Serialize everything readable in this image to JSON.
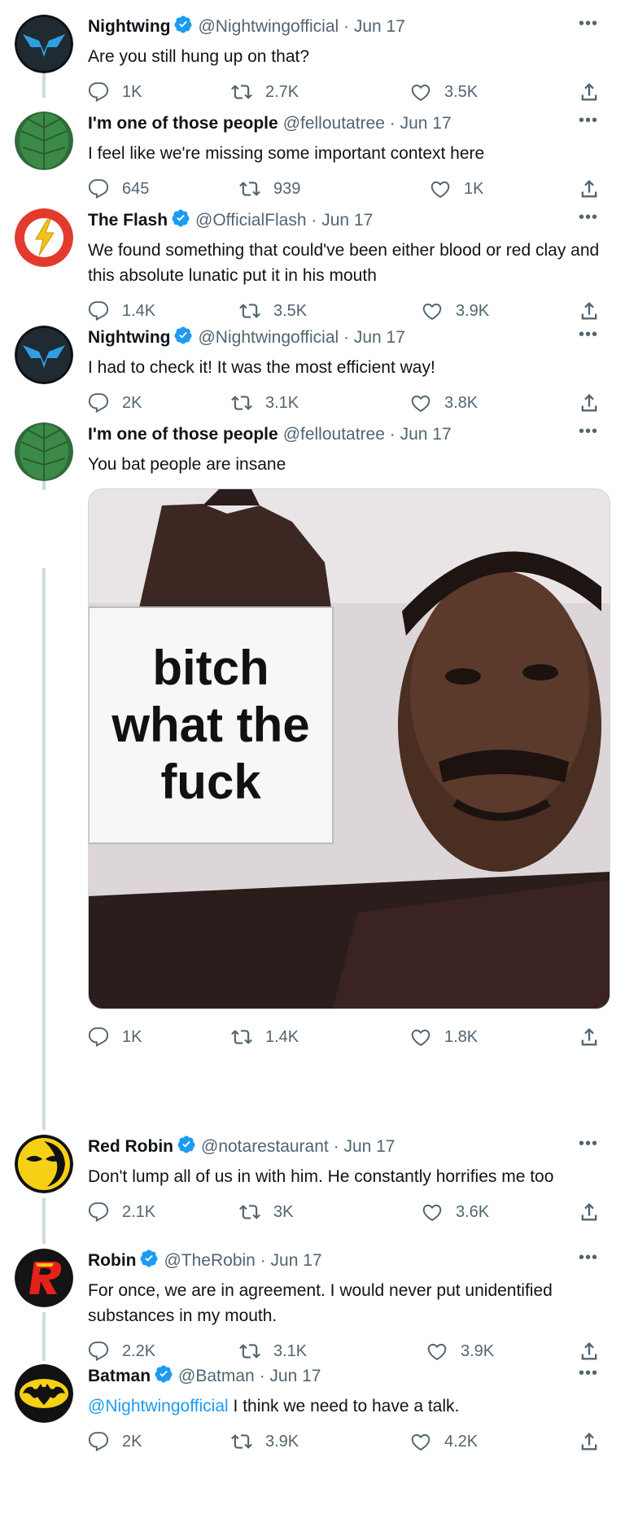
{
  "tweets": [
    {
      "name": "Nightwing",
      "verified": true,
      "handle": "@Nightwingofficial",
      "sep": "·",
      "date": "Jun 17",
      "text": "Are you still hung up on that?",
      "replies": "1K",
      "retweets": "2.7K",
      "likes": "3.5K",
      "avatar": "nightwing-logo"
    },
    {
      "name": "I'm one of those people",
      "verified": false,
      "handle": "@felloutatree",
      "sep": "·",
      "date": "Jun 17",
      "text": "I feel like we're missing some important context here",
      "replies": "645",
      "retweets": "939",
      "likes": "1K",
      "avatar": "green-leaf"
    },
    {
      "name": "The Flash",
      "verified": true,
      "handle": "@OfficialFlash",
      "sep": "·",
      "date": "Jun 17",
      "text": "We found something that could've been either blood or red clay and this absolute lunatic put it in his mouth",
      "replies": "1.4K",
      "retweets": "3.5K",
      "likes": "3.9K",
      "avatar": "flash-logo"
    },
    {
      "name": "Nightwing",
      "verified": true,
      "handle": "@Nightwingofficial",
      "sep": "·",
      "date": "Jun 17",
      "text": "I had to check it! It was the most efficient way!",
      "replies": "2K",
      "retweets": "3.1K",
      "likes": "3.8K",
      "avatar": "nightwing-logo"
    },
    {
      "name": "I'm one of those people",
      "verified": false,
      "handle": "@felloutatree",
      "sep": "·",
      "date": "Jun 17",
      "text": "You bat people are insane",
      "replies": "1K",
      "retweets": "1.4K",
      "likes": "1.8K",
      "avatar": "green-leaf",
      "media_text": [
        "bitch",
        "what the",
        "fuck"
      ]
    },
    {
      "name": "Red Robin",
      "verified": true,
      "handle": "@notarestaurant",
      "sep": "·",
      "date": "Jun 17",
      "text": "Don't lump all of us in with him. He constantly horrifies me too",
      "replies": "2.1K",
      "retweets": "3K",
      "likes": "3.6K",
      "avatar": "red-robin-logo"
    },
    {
      "name": "Robin",
      "verified": true,
      "handle": "@TheRobin",
      "sep": "·",
      "date": "Jun 17",
      "text": "For once, we are in agreement. I would never put unidentified substances in my mouth.",
      "replies": "2.2K",
      "retweets": "3.1K",
      "likes": "3.9K",
      "avatar": "robin-logo"
    },
    {
      "name": "Batman",
      "verified": true,
      "handle": "@Batman",
      "sep": "·",
      "date": "Jun 17",
      "mention": "@Nightwingofficial",
      "text": " I think we need to have a talk.",
      "replies": "2K",
      "retweets": "3.9K",
      "likes": "4.2K",
      "avatar": "batman-logo"
    }
  ],
  "icons": {
    "reply": "reply-icon",
    "retweet": "retweet-icon",
    "like": "heart-icon",
    "share": "share-icon",
    "more": "more-icon",
    "verified": "verified-badge-icon"
  },
  "colors": {
    "accent": "#1d9bf0",
    "muted": "#536471",
    "text": "#0f1419",
    "thread": "#cfd9de"
  }
}
